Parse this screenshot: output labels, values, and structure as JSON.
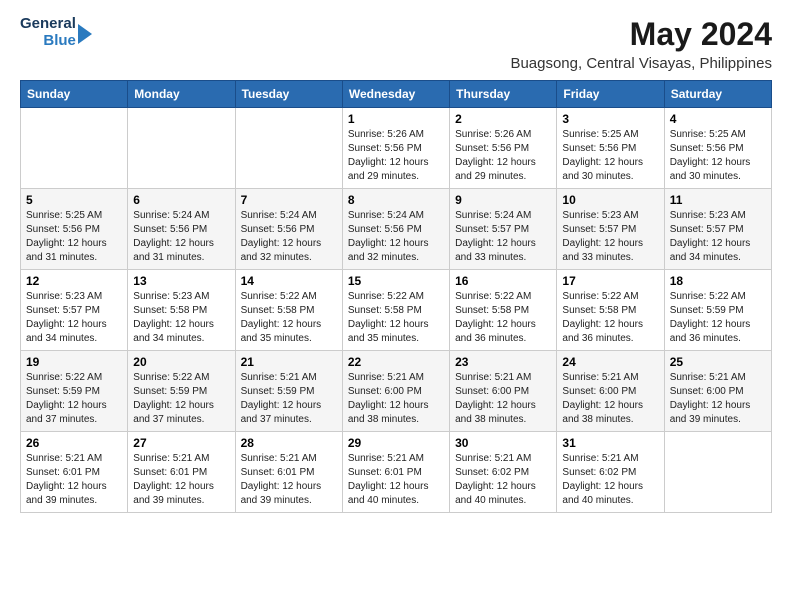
{
  "logo": {
    "line1": "General",
    "line2": "Blue"
  },
  "title": "May 2024",
  "subtitle": "Buagsong, Central Visayas, Philippines",
  "weekdays": [
    "Sunday",
    "Monday",
    "Tuesday",
    "Wednesday",
    "Thursday",
    "Friday",
    "Saturday"
  ],
  "weeks": [
    [
      {
        "day": "",
        "info": ""
      },
      {
        "day": "",
        "info": ""
      },
      {
        "day": "",
        "info": ""
      },
      {
        "day": "1",
        "info": "Sunrise: 5:26 AM\nSunset: 5:56 PM\nDaylight: 12 hours\nand 29 minutes."
      },
      {
        "day": "2",
        "info": "Sunrise: 5:26 AM\nSunset: 5:56 PM\nDaylight: 12 hours\nand 29 minutes."
      },
      {
        "day": "3",
        "info": "Sunrise: 5:25 AM\nSunset: 5:56 PM\nDaylight: 12 hours\nand 30 minutes."
      },
      {
        "day": "4",
        "info": "Sunrise: 5:25 AM\nSunset: 5:56 PM\nDaylight: 12 hours\nand 30 minutes."
      }
    ],
    [
      {
        "day": "5",
        "info": "Sunrise: 5:25 AM\nSunset: 5:56 PM\nDaylight: 12 hours\nand 31 minutes."
      },
      {
        "day": "6",
        "info": "Sunrise: 5:24 AM\nSunset: 5:56 PM\nDaylight: 12 hours\nand 31 minutes."
      },
      {
        "day": "7",
        "info": "Sunrise: 5:24 AM\nSunset: 5:56 PM\nDaylight: 12 hours\nand 32 minutes."
      },
      {
        "day": "8",
        "info": "Sunrise: 5:24 AM\nSunset: 5:56 PM\nDaylight: 12 hours\nand 32 minutes."
      },
      {
        "day": "9",
        "info": "Sunrise: 5:24 AM\nSunset: 5:57 PM\nDaylight: 12 hours\nand 33 minutes."
      },
      {
        "day": "10",
        "info": "Sunrise: 5:23 AM\nSunset: 5:57 PM\nDaylight: 12 hours\nand 33 minutes."
      },
      {
        "day": "11",
        "info": "Sunrise: 5:23 AM\nSunset: 5:57 PM\nDaylight: 12 hours\nand 34 minutes."
      }
    ],
    [
      {
        "day": "12",
        "info": "Sunrise: 5:23 AM\nSunset: 5:57 PM\nDaylight: 12 hours\nand 34 minutes."
      },
      {
        "day": "13",
        "info": "Sunrise: 5:23 AM\nSunset: 5:58 PM\nDaylight: 12 hours\nand 34 minutes."
      },
      {
        "day": "14",
        "info": "Sunrise: 5:22 AM\nSunset: 5:58 PM\nDaylight: 12 hours\nand 35 minutes."
      },
      {
        "day": "15",
        "info": "Sunrise: 5:22 AM\nSunset: 5:58 PM\nDaylight: 12 hours\nand 35 minutes."
      },
      {
        "day": "16",
        "info": "Sunrise: 5:22 AM\nSunset: 5:58 PM\nDaylight: 12 hours\nand 36 minutes."
      },
      {
        "day": "17",
        "info": "Sunrise: 5:22 AM\nSunset: 5:58 PM\nDaylight: 12 hours\nand 36 minutes."
      },
      {
        "day": "18",
        "info": "Sunrise: 5:22 AM\nSunset: 5:59 PM\nDaylight: 12 hours\nand 36 minutes."
      }
    ],
    [
      {
        "day": "19",
        "info": "Sunrise: 5:22 AM\nSunset: 5:59 PM\nDaylight: 12 hours\nand 37 minutes."
      },
      {
        "day": "20",
        "info": "Sunrise: 5:22 AM\nSunset: 5:59 PM\nDaylight: 12 hours\nand 37 minutes."
      },
      {
        "day": "21",
        "info": "Sunrise: 5:21 AM\nSunset: 5:59 PM\nDaylight: 12 hours\nand 37 minutes."
      },
      {
        "day": "22",
        "info": "Sunrise: 5:21 AM\nSunset: 6:00 PM\nDaylight: 12 hours\nand 38 minutes."
      },
      {
        "day": "23",
        "info": "Sunrise: 5:21 AM\nSunset: 6:00 PM\nDaylight: 12 hours\nand 38 minutes."
      },
      {
        "day": "24",
        "info": "Sunrise: 5:21 AM\nSunset: 6:00 PM\nDaylight: 12 hours\nand 38 minutes."
      },
      {
        "day": "25",
        "info": "Sunrise: 5:21 AM\nSunset: 6:00 PM\nDaylight: 12 hours\nand 39 minutes."
      }
    ],
    [
      {
        "day": "26",
        "info": "Sunrise: 5:21 AM\nSunset: 6:01 PM\nDaylight: 12 hours\nand 39 minutes."
      },
      {
        "day": "27",
        "info": "Sunrise: 5:21 AM\nSunset: 6:01 PM\nDaylight: 12 hours\nand 39 minutes."
      },
      {
        "day": "28",
        "info": "Sunrise: 5:21 AM\nSunset: 6:01 PM\nDaylight: 12 hours\nand 39 minutes."
      },
      {
        "day": "29",
        "info": "Sunrise: 5:21 AM\nSunset: 6:01 PM\nDaylight: 12 hours\nand 40 minutes."
      },
      {
        "day": "30",
        "info": "Sunrise: 5:21 AM\nSunset: 6:02 PM\nDaylight: 12 hours\nand 40 minutes."
      },
      {
        "day": "31",
        "info": "Sunrise: 5:21 AM\nSunset: 6:02 PM\nDaylight: 12 hours\nand 40 minutes."
      },
      {
        "day": "",
        "info": ""
      }
    ]
  ]
}
